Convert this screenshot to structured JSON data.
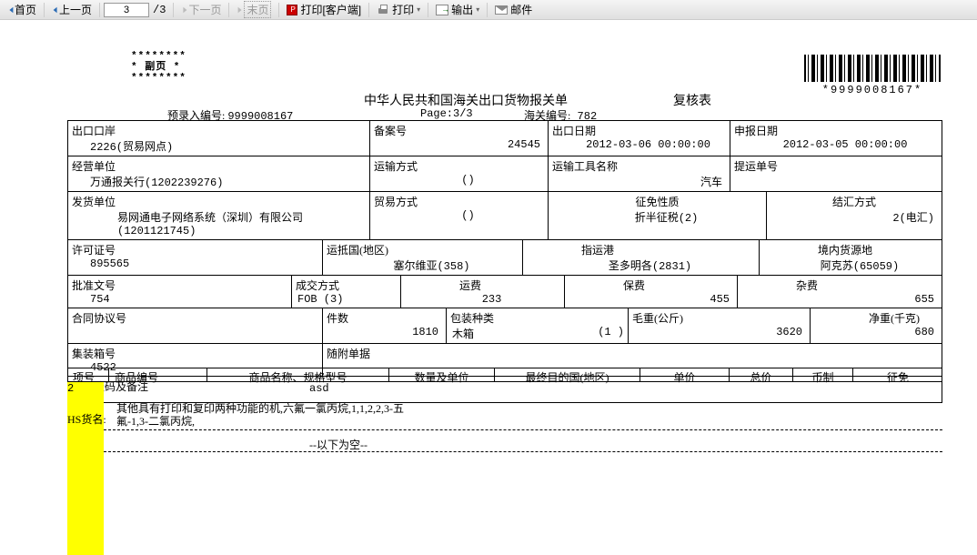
{
  "toolbar": {
    "first": "首页",
    "prev": "上一页",
    "page_current": "3",
    "page_total": "/3",
    "next": "下一页",
    "last": "末页",
    "print_client": "打印[客户端]",
    "print": "打印",
    "export": "输出",
    "mail": "邮件"
  },
  "header": {
    "stars_top": "********",
    "stars_mid": "* 副页 *",
    "stars_bot": "********",
    "title": "中华人民共和国海关出口货物报关单",
    "sub_title": "复核表",
    "barcode_text": "*9999008167*",
    "pre_entry_label": "预录入编号:",
    "pre_entry_val": "9999008167",
    "page_label": "Page:3/3",
    "customs_no_label": "海关编号:",
    "customs_no_val": "782"
  },
  "form": {
    "export_port_lbl": "出口口岸",
    "export_port_val": "2226(贸易网点)",
    "record_no_lbl": "备案号",
    "record_no_val": "24545",
    "export_date_lbl": "出口日期",
    "export_date_val": "2012-03-06 00:00:00",
    "declare_date_lbl": "申报日期",
    "declare_date_val": "2012-03-05 00:00:00",
    "operator_lbl": "经营单位",
    "operator_val": "万通报关行(1202239276)",
    "transport_mode_lbl": "运输方式",
    "transport_mode_val": "()",
    "transport_tool_lbl": "运输工具名称",
    "transport_tool_val": "汽车",
    "bill_no_lbl": "提运单号",
    "shipper_lbl": "发货单位",
    "shipper_val1": "易网通电子网络系统（深圳）有限公司",
    "shipper_val2": "(1201121745)",
    "trade_mode_lbl": "贸易方式",
    "trade_mode_val": "()",
    "levy_nature_lbl": "征免性质",
    "levy_nature_val": "折半征税(2)",
    "settle_mode_lbl": "结汇方式",
    "settle_mode_val": "2(电汇)",
    "license_no_lbl": "许可证号",
    "license_no_val": "895565",
    "arrival_country_lbl": "运抵国(地区)",
    "arrival_country_val": "塞尔维亚(358)",
    "loading_port_lbl": "指运港",
    "loading_port_val": "圣多明各(2831)",
    "domestic_src_lbl": "境内货源地",
    "domestic_src_val": "阿克苏(65059)",
    "approval_no_lbl": "批准文号",
    "approval_no_val": "754",
    "deal_mode_lbl": "成交方式",
    "deal_mode_val": "FOB  (3)",
    "freight_lbl": "运费",
    "freight_val": "233",
    "insurance_lbl": "保费",
    "insurance_val": "455",
    "misc_fee_lbl": "杂费",
    "misc_fee_val": "655",
    "contract_no_lbl": "合同协议号",
    "pieces_lbl": "件数",
    "pieces_val": "1810",
    "pack_type_lbl": "包装种类",
    "pack_type_val": "木箱",
    "pack_type_code": "(1 )",
    "gross_wt_lbl": "毛重(公斤)",
    "gross_wt_val": "3620",
    "net_wt_lbl": "净重(千克)",
    "net_wt_val": "680",
    "container_no_lbl": "集装箱号",
    "container_no_val": "4522",
    "attached_docs_lbl": "随附单据",
    "marks_lbl": "标记唛码及备注"
  },
  "detail_headers": {
    "item_no": "项号",
    "commodity_no": "商品编号",
    "commodity_name": "商品名称、规格型号",
    "qty_unit": "数量及单位",
    "final_dest": "最终目的国(地区)",
    "unit_price": "单价",
    "total_price": "总价",
    "currency": "币制",
    "levy_exempt": "征免"
  },
  "items": [
    {
      "no": "2",
      "name": "asd",
      "hs_label": "HS货名:",
      "hs_desc": "其他具有打印和复印两种功能的机,六氟一氯丙烷,1,1,2,2,3-五氟-1,3-二氯丙烷,"
    }
  ],
  "empty_note": "--以下为空--"
}
